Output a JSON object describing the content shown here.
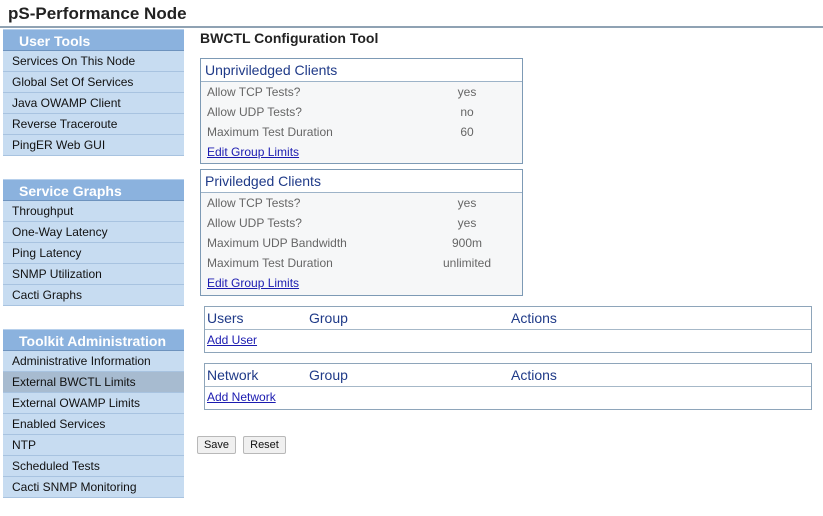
{
  "header": {
    "title": "pS-Performance Node"
  },
  "sidebar": {
    "sections": [
      {
        "title": "User Tools",
        "items": [
          "Services On This Node",
          "Global Set Of Services",
          "Java OWAMP Client",
          "Reverse Traceroute",
          "PingER Web GUI"
        ]
      },
      {
        "title": "Service Graphs",
        "items": [
          "Throughput",
          "One-Way Latency",
          "Ping Latency",
          "SNMP Utilization",
          "Cacti Graphs"
        ]
      },
      {
        "title": "Toolkit Administration",
        "items": [
          "Administrative Information",
          "External BWCTL Limits",
          "External OWAMP Limits",
          "Enabled Services",
          "NTP",
          "Scheduled Tests",
          "Cacti SNMP Monitoring"
        ]
      }
    ],
    "active_item": "External BWCTL Limits"
  },
  "main": {
    "title": "BWCTL Configuration Tool",
    "unprivileged": {
      "title": "Unpriviledged Clients",
      "rows": [
        {
          "label": "Allow TCP Tests?",
          "value": "yes"
        },
        {
          "label": "Allow UDP Tests?",
          "value": "no"
        },
        {
          "label": "Maximum Test Duration",
          "value": "60"
        }
      ],
      "link": "Edit Group Limits"
    },
    "privileged": {
      "title": "Priviledged Clients",
      "rows": [
        {
          "label": "Allow TCP Tests?",
          "value": "yes"
        },
        {
          "label": "Allow UDP Tests?",
          "value": "yes"
        },
        {
          "label": "Maximum UDP Bandwidth",
          "value": "900m"
        },
        {
          "label": "Maximum Test Duration",
          "value": "unlimited"
        }
      ],
      "link": "Edit Group Limits"
    },
    "users_table": {
      "col1": "Users",
      "col2": "Group",
      "col3": "Actions",
      "link": "Add User"
    },
    "network_table": {
      "col1": "Network",
      "col2": "Group",
      "col3": "Actions",
      "link": "Add Network"
    },
    "buttons": {
      "save": "Save",
      "reset": "Reset"
    }
  }
}
